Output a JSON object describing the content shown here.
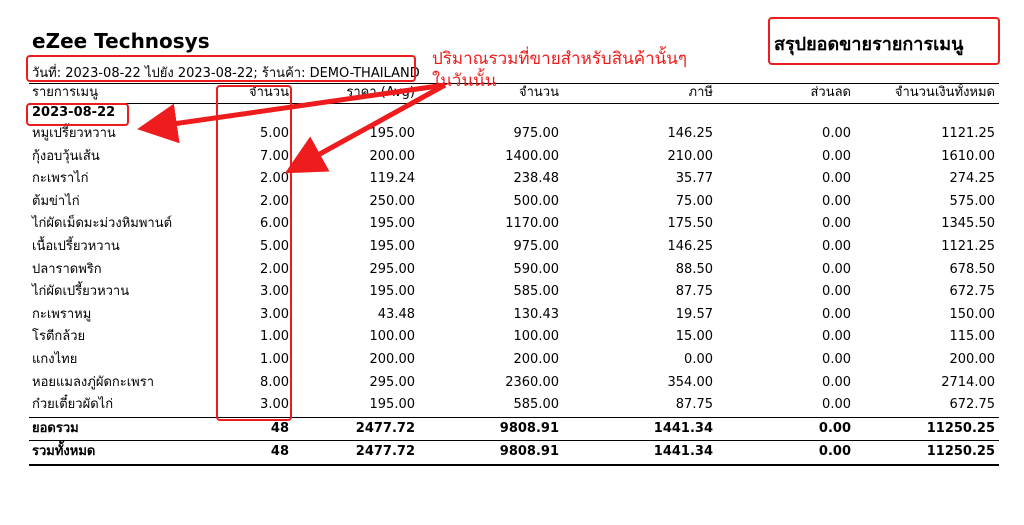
{
  "report": {
    "company": "eZee Technosys",
    "title": "สรุปยอดขายรายการเมนู",
    "subtitle": "วันที่: 2023-08-22 ไปยัง 2023-08-22; ร้านค้า: DEMO-THAILAND"
  },
  "table": {
    "columns": [
      "รายการเมนู",
      "จำนวน",
      "ราคา (Avg)",
      "จำนวน",
      "ภาษี",
      "ส่วนลด",
      "จำนวนเงินทั้งหมด"
    ],
    "date": "2023-08-22",
    "rows": [
      [
        "หมูเปรี้ยวหวาน",
        "5.00",
        "195.00",
        "975.00",
        "146.25",
        "0.00",
        "1121.25"
      ],
      [
        "กุ้งอบวุ้นเส้น",
        "7.00",
        "200.00",
        "1400.00",
        "210.00",
        "0.00",
        "1610.00"
      ],
      [
        "กะเพราไก่",
        "2.00",
        "119.24",
        "238.48",
        "35.77",
        "0.00",
        "274.25"
      ],
      [
        "ต้มข่าไก่",
        "2.00",
        "250.00",
        "500.00",
        "75.00",
        "0.00",
        "575.00"
      ],
      [
        "ไก่ผัดเม็ดมะม่วงหิมพานต์",
        "6.00",
        "195.00",
        "1170.00",
        "175.50",
        "0.00",
        "1345.50"
      ],
      [
        "เนื้อเปรี้ยวหวาน",
        "5.00",
        "195.00",
        "975.00",
        "146.25",
        "0.00",
        "1121.25"
      ],
      [
        "ปลาราดพริก",
        "2.00",
        "295.00",
        "590.00",
        "88.50",
        "0.00",
        "678.50"
      ],
      [
        "ไก่ผัดเปรี้ยวหวาน",
        "3.00",
        "195.00",
        "585.00",
        "87.75",
        "0.00",
        "672.75"
      ],
      [
        "กะเพราหมู",
        "3.00",
        "43.48",
        "130.43",
        "19.57",
        "0.00",
        "150.00"
      ],
      [
        "โรตีกล้วย",
        "1.00",
        "100.00",
        "100.00",
        "15.00",
        "0.00",
        "115.00"
      ],
      [
        "แกงไทย",
        "1.00",
        "200.00",
        "200.00",
        "0.00",
        "0.00",
        "200.00"
      ],
      [
        "หอยแมลงภู่ผัดกะเพรา",
        "8.00",
        "295.00",
        "2360.00",
        "354.00",
        "0.00",
        "2714.00"
      ],
      [
        "ก๋วยเตี๋ยวผัดไก่",
        "3.00",
        "195.00",
        "585.00",
        "87.75",
        "0.00",
        "672.75"
      ]
    ],
    "subtotal": [
      "ยอดรวม",
      "48",
      "2477.72",
      "9808.91",
      "1441.34",
      "0.00",
      "11250.25"
    ],
    "grand_total": [
      "รวมทั้งหมด",
      "48",
      "2477.72",
      "9808.91",
      "1441.34",
      "0.00",
      "11250.25"
    ]
  },
  "annotation": {
    "text_line1": "ปริมาณรวมที่ขายสำหรับสินค้านั้นๆ",
    "text_line2": "ในวันนั้น",
    "color": "#ee1c1c"
  }
}
